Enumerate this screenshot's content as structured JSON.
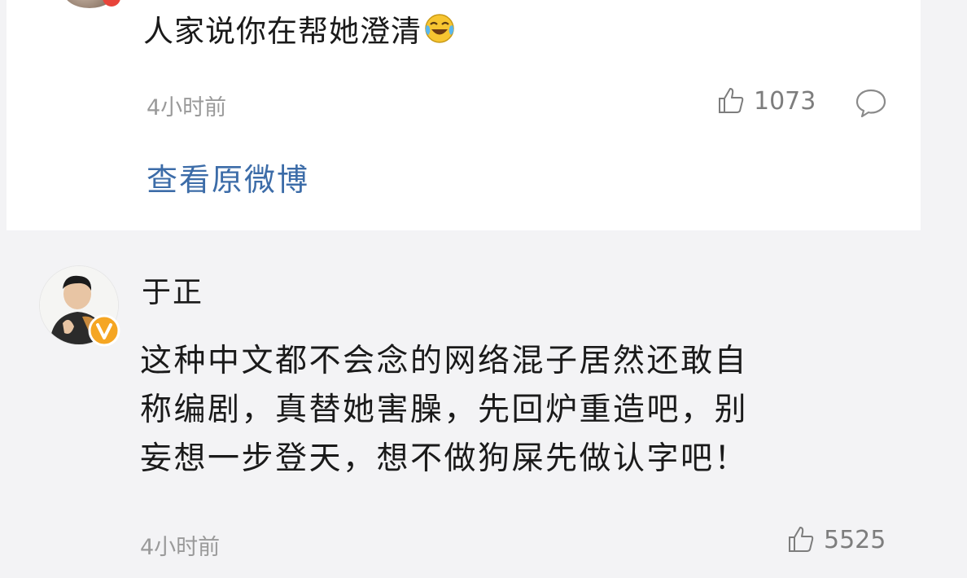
{
  "quoted_comment": {
    "text": "人家说你在帮她澄清",
    "emoji": "laughing-crying-emoji",
    "time": "4小时前",
    "likes": "1073",
    "view_original_label": "查看原微博"
  },
  "comment": {
    "username": "于正",
    "verified_badge": "v-verified-badge",
    "lines": [
      "这种中文都不会念的网络混子居然还敢自",
      "称编剧，真替她害臊，先回炉重造吧，别",
      "妄想一步登天，想不做狗屎先做认字吧！"
    ],
    "time": "4小时前",
    "likes": "5525"
  },
  "colors": {
    "background": "#f3f3f5",
    "card": "#ffffff",
    "link": "#3c6ca8",
    "meta_text": "#9a9a9a",
    "badge": "#f5a623"
  }
}
